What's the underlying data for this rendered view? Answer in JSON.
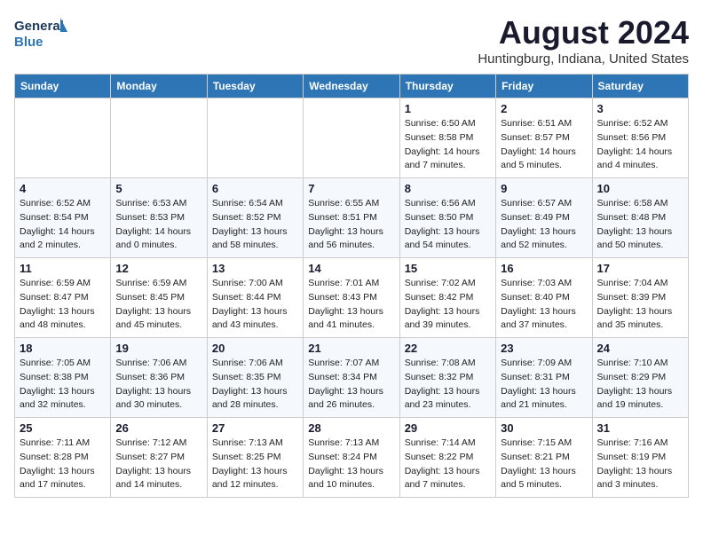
{
  "logo": {
    "line1": "General",
    "line2": "Blue"
  },
  "title": "August 2024",
  "location": "Huntingburg, Indiana, United States",
  "headers": [
    "Sunday",
    "Monday",
    "Tuesday",
    "Wednesday",
    "Thursday",
    "Friday",
    "Saturday"
  ],
  "weeks": [
    [
      {
        "day": "",
        "info": ""
      },
      {
        "day": "",
        "info": ""
      },
      {
        "day": "",
        "info": ""
      },
      {
        "day": "",
        "info": ""
      },
      {
        "day": "1",
        "info": "Sunrise: 6:50 AM\nSunset: 8:58 PM\nDaylight: 14 hours\nand 7 minutes."
      },
      {
        "day": "2",
        "info": "Sunrise: 6:51 AM\nSunset: 8:57 PM\nDaylight: 14 hours\nand 5 minutes."
      },
      {
        "day": "3",
        "info": "Sunrise: 6:52 AM\nSunset: 8:56 PM\nDaylight: 14 hours\nand 4 minutes."
      }
    ],
    [
      {
        "day": "4",
        "info": "Sunrise: 6:52 AM\nSunset: 8:54 PM\nDaylight: 14 hours\nand 2 minutes."
      },
      {
        "day": "5",
        "info": "Sunrise: 6:53 AM\nSunset: 8:53 PM\nDaylight: 14 hours\nand 0 minutes."
      },
      {
        "day": "6",
        "info": "Sunrise: 6:54 AM\nSunset: 8:52 PM\nDaylight: 13 hours\nand 58 minutes."
      },
      {
        "day": "7",
        "info": "Sunrise: 6:55 AM\nSunset: 8:51 PM\nDaylight: 13 hours\nand 56 minutes."
      },
      {
        "day": "8",
        "info": "Sunrise: 6:56 AM\nSunset: 8:50 PM\nDaylight: 13 hours\nand 54 minutes."
      },
      {
        "day": "9",
        "info": "Sunrise: 6:57 AM\nSunset: 8:49 PM\nDaylight: 13 hours\nand 52 minutes."
      },
      {
        "day": "10",
        "info": "Sunrise: 6:58 AM\nSunset: 8:48 PM\nDaylight: 13 hours\nand 50 minutes."
      }
    ],
    [
      {
        "day": "11",
        "info": "Sunrise: 6:59 AM\nSunset: 8:47 PM\nDaylight: 13 hours\nand 48 minutes."
      },
      {
        "day": "12",
        "info": "Sunrise: 6:59 AM\nSunset: 8:45 PM\nDaylight: 13 hours\nand 45 minutes."
      },
      {
        "day": "13",
        "info": "Sunrise: 7:00 AM\nSunset: 8:44 PM\nDaylight: 13 hours\nand 43 minutes."
      },
      {
        "day": "14",
        "info": "Sunrise: 7:01 AM\nSunset: 8:43 PM\nDaylight: 13 hours\nand 41 minutes."
      },
      {
        "day": "15",
        "info": "Sunrise: 7:02 AM\nSunset: 8:42 PM\nDaylight: 13 hours\nand 39 minutes."
      },
      {
        "day": "16",
        "info": "Sunrise: 7:03 AM\nSunset: 8:40 PM\nDaylight: 13 hours\nand 37 minutes."
      },
      {
        "day": "17",
        "info": "Sunrise: 7:04 AM\nSunset: 8:39 PM\nDaylight: 13 hours\nand 35 minutes."
      }
    ],
    [
      {
        "day": "18",
        "info": "Sunrise: 7:05 AM\nSunset: 8:38 PM\nDaylight: 13 hours\nand 32 minutes."
      },
      {
        "day": "19",
        "info": "Sunrise: 7:06 AM\nSunset: 8:36 PM\nDaylight: 13 hours\nand 30 minutes."
      },
      {
        "day": "20",
        "info": "Sunrise: 7:06 AM\nSunset: 8:35 PM\nDaylight: 13 hours\nand 28 minutes."
      },
      {
        "day": "21",
        "info": "Sunrise: 7:07 AM\nSunset: 8:34 PM\nDaylight: 13 hours\nand 26 minutes."
      },
      {
        "day": "22",
        "info": "Sunrise: 7:08 AM\nSunset: 8:32 PM\nDaylight: 13 hours\nand 23 minutes."
      },
      {
        "day": "23",
        "info": "Sunrise: 7:09 AM\nSunset: 8:31 PM\nDaylight: 13 hours\nand 21 minutes."
      },
      {
        "day": "24",
        "info": "Sunrise: 7:10 AM\nSunset: 8:29 PM\nDaylight: 13 hours\nand 19 minutes."
      }
    ],
    [
      {
        "day": "25",
        "info": "Sunrise: 7:11 AM\nSunset: 8:28 PM\nDaylight: 13 hours\nand 17 minutes."
      },
      {
        "day": "26",
        "info": "Sunrise: 7:12 AM\nSunset: 8:27 PM\nDaylight: 13 hours\nand 14 minutes."
      },
      {
        "day": "27",
        "info": "Sunrise: 7:13 AM\nSunset: 8:25 PM\nDaylight: 13 hours\nand 12 minutes."
      },
      {
        "day": "28",
        "info": "Sunrise: 7:13 AM\nSunset: 8:24 PM\nDaylight: 13 hours\nand 10 minutes."
      },
      {
        "day": "29",
        "info": "Sunrise: 7:14 AM\nSunset: 8:22 PM\nDaylight: 13 hours\nand 7 minutes."
      },
      {
        "day": "30",
        "info": "Sunrise: 7:15 AM\nSunset: 8:21 PM\nDaylight: 13 hours\nand 5 minutes."
      },
      {
        "day": "31",
        "info": "Sunrise: 7:16 AM\nSunset: 8:19 PM\nDaylight: 13 hours\nand 3 minutes."
      }
    ]
  ]
}
